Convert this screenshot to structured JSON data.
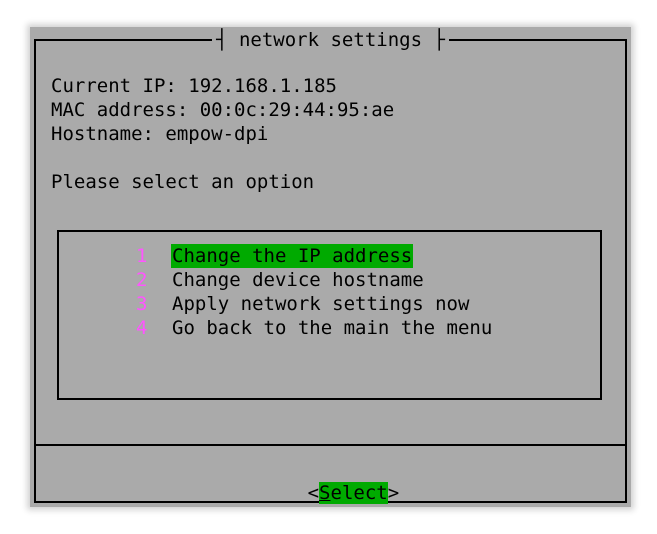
{
  "dialog": {
    "title": "network settings",
    "title_left_deco": "┤",
    "title_right_deco": "├"
  },
  "info": {
    "current_ip": "Current IP: 192.168.1.185",
    "mac_address": "MAC address: 00:0c:29:44:95:ae",
    "hostname": "Hostname: empow-dpi",
    "prompt": "Please select an option"
  },
  "menu": {
    "items": [
      {
        "number": "1",
        "label": "Change the IP address",
        "selected": true
      },
      {
        "number": "2",
        "label": "Change device hostname",
        "selected": false
      },
      {
        "number": "3",
        "label": "Apply network settings now",
        "selected": false
      },
      {
        "number": "4",
        "label": "Go back to the main the menu",
        "selected": false
      }
    ]
  },
  "buttons": {
    "select_left": "<",
    "select_hotkey": "S",
    "select_rest": "elect",
    "select_right": ">"
  },
  "colors": {
    "dialog_bg": "#aaaaaa",
    "highlight": "#00aa00",
    "number": "#ff55ff",
    "text": "#000000"
  }
}
